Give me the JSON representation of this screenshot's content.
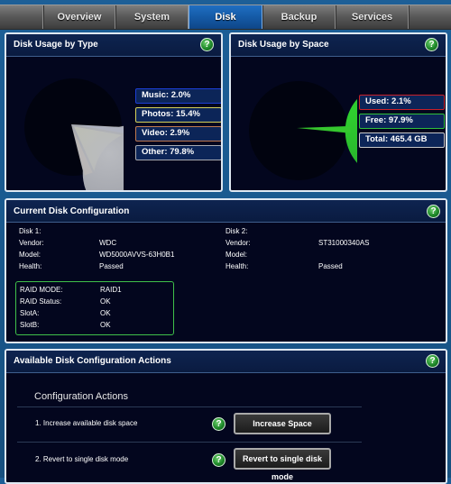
{
  "tabs": [
    {
      "label": "Overview",
      "active": false
    },
    {
      "label": "System",
      "active": false
    },
    {
      "label": "Disk",
      "active": true
    },
    {
      "label": "Backup",
      "active": false
    },
    {
      "label": "Services",
      "active": false
    }
  ],
  "help_icon": "question-mark-icon",
  "help_glyph": "?",
  "usage_by_type": {
    "title": "Disk Usage by Type",
    "legend": [
      {
        "label": "Music: 2.0%",
        "color": "#1c3fd6"
      },
      {
        "label": "Photos: 15.4%",
        "color": "#e3e04a"
      },
      {
        "label": "Video: 2.9%",
        "color": "#d8852a"
      },
      {
        "label": "Other: 79.8%",
        "color": "#b9bbc0"
      }
    ]
  },
  "usage_by_space": {
    "title": "Disk Usage by Space",
    "legend": [
      {
        "label": "Used: 2.1%",
        "color": "#d0202a"
      },
      {
        "label": "Free: 97.9%",
        "color": "#2fd02f"
      },
      {
        "label": "Total: 465.4 GB",
        "color": "#c8c8c8"
      }
    ]
  },
  "chart_data": [
    {
      "type": "pie",
      "title": "Disk Usage by Type",
      "categories": [
        "Music",
        "Photos",
        "Video",
        "Other"
      ],
      "values": [
        2.0,
        15.4,
        2.9,
        79.8
      ],
      "colors": [
        "#1c3fd6",
        "#e3e04a",
        "#d8852a",
        "#b9bbc0"
      ],
      "legend": "right"
    },
    {
      "type": "pie",
      "title": "Disk Usage by Space",
      "categories": [
        "Used",
        "Free"
      ],
      "values": [
        2.1,
        97.9
      ],
      "colors": [
        "#d0202a",
        "#2fd02f"
      ],
      "total": "465.4 GB",
      "legend": "right"
    }
  ],
  "current_config": {
    "title": "Current Disk Configuration",
    "disk1": {
      "heading": "Disk 1:",
      "rows": [
        {
          "label": "Vendor:",
          "value": "WDC"
        },
        {
          "label": "Model:",
          "value": "WD5000AVVS-63H0B1"
        },
        {
          "label": "Health:",
          "value": "Passed"
        }
      ]
    },
    "disk2": {
      "heading": "Disk 2:",
      "rows": [
        {
          "label": "Vendor:",
          "value": "ST31000340AS"
        },
        {
          "label": "Model:",
          "value": ""
        },
        {
          "label": "Health:",
          "value": "Passed"
        }
      ]
    },
    "raid": [
      {
        "label": "RAID MODE:",
        "value": "RAID1"
      },
      {
        "label": "RAID Status:",
        "value": "OK"
      },
      {
        "label": "SlotA:",
        "value": "OK"
      },
      {
        "label": "SlotB:",
        "value": "OK"
      }
    ]
  },
  "actions": {
    "title": "Available Disk Configuration Actions",
    "subtitle": "Configuration Actions",
    "items": [
      {
        "label": "1. Increase available disk space",
        "button": "Increase Space"
      },
      {
        "label": "2. Revert to single disk mode",
        "button": "Revert to single disk mode"
      }
    ]
  }
}
